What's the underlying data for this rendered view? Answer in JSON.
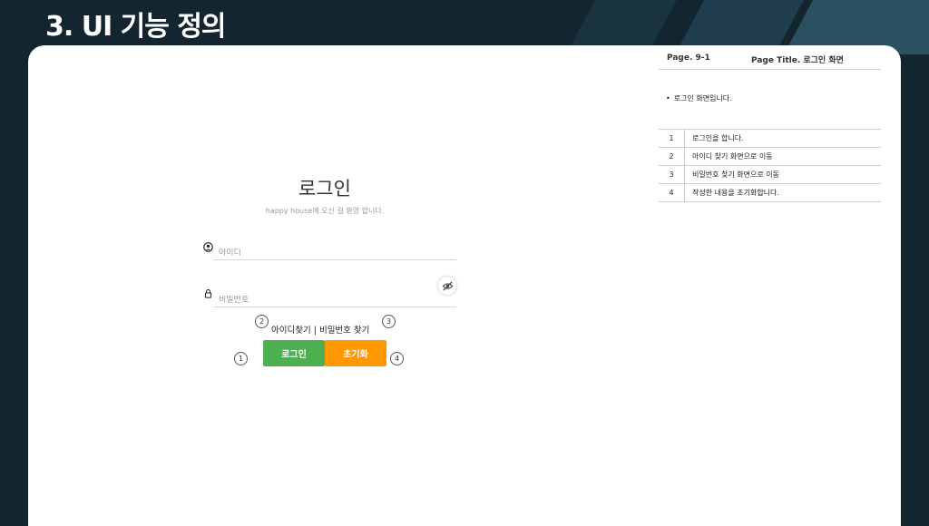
{
  "slide": {
    "title": "3. UI 기능 정의"
  },
  "spec": {
    "page_label": "Page. 9-1",
    "page_title": "Page Title. 로그인 화면",
    "description": "로그인 화면입니다.",
    "rows": [
      {
        "num": "1",
        "text": "로그인을 합니다."
      },
      {
        "num": "2",
        "text": "아이디 찾기 화면으로 이동"
      },
      {
        "num": "3",
        "text": "비밀번호 찾기 화면으로 이동"
      },
      {
        "num": "4",
        "text": "작성한 내용을 초기화합니다."
      }
    ]
  },
  "login": {
    "title": "로그인",
    "subtitle": "happy house에 오신 걸 환영 합니다.",
    "id_placeholder": "아이디",
    "pw_placeholder": "비밀번호",
    "find_id": "아이디찾기",
    "separator": " | ",
    "find_pw": "비밀번호 찾기",
    "login_button": "로그인",
    "reset_button": "초기화"
  },
  "badges": {
    "b1": "1",
    "b2": "2",
    "b3": "3",
    "b4": "4"
  },
  "colors": {
    "login": "#4caf50",
    "reset": "#ff9800"
  },
  "icons": [
    "user-circle-icon",
    "lock-icon",
    "eye-off-icon"
  ]
}
